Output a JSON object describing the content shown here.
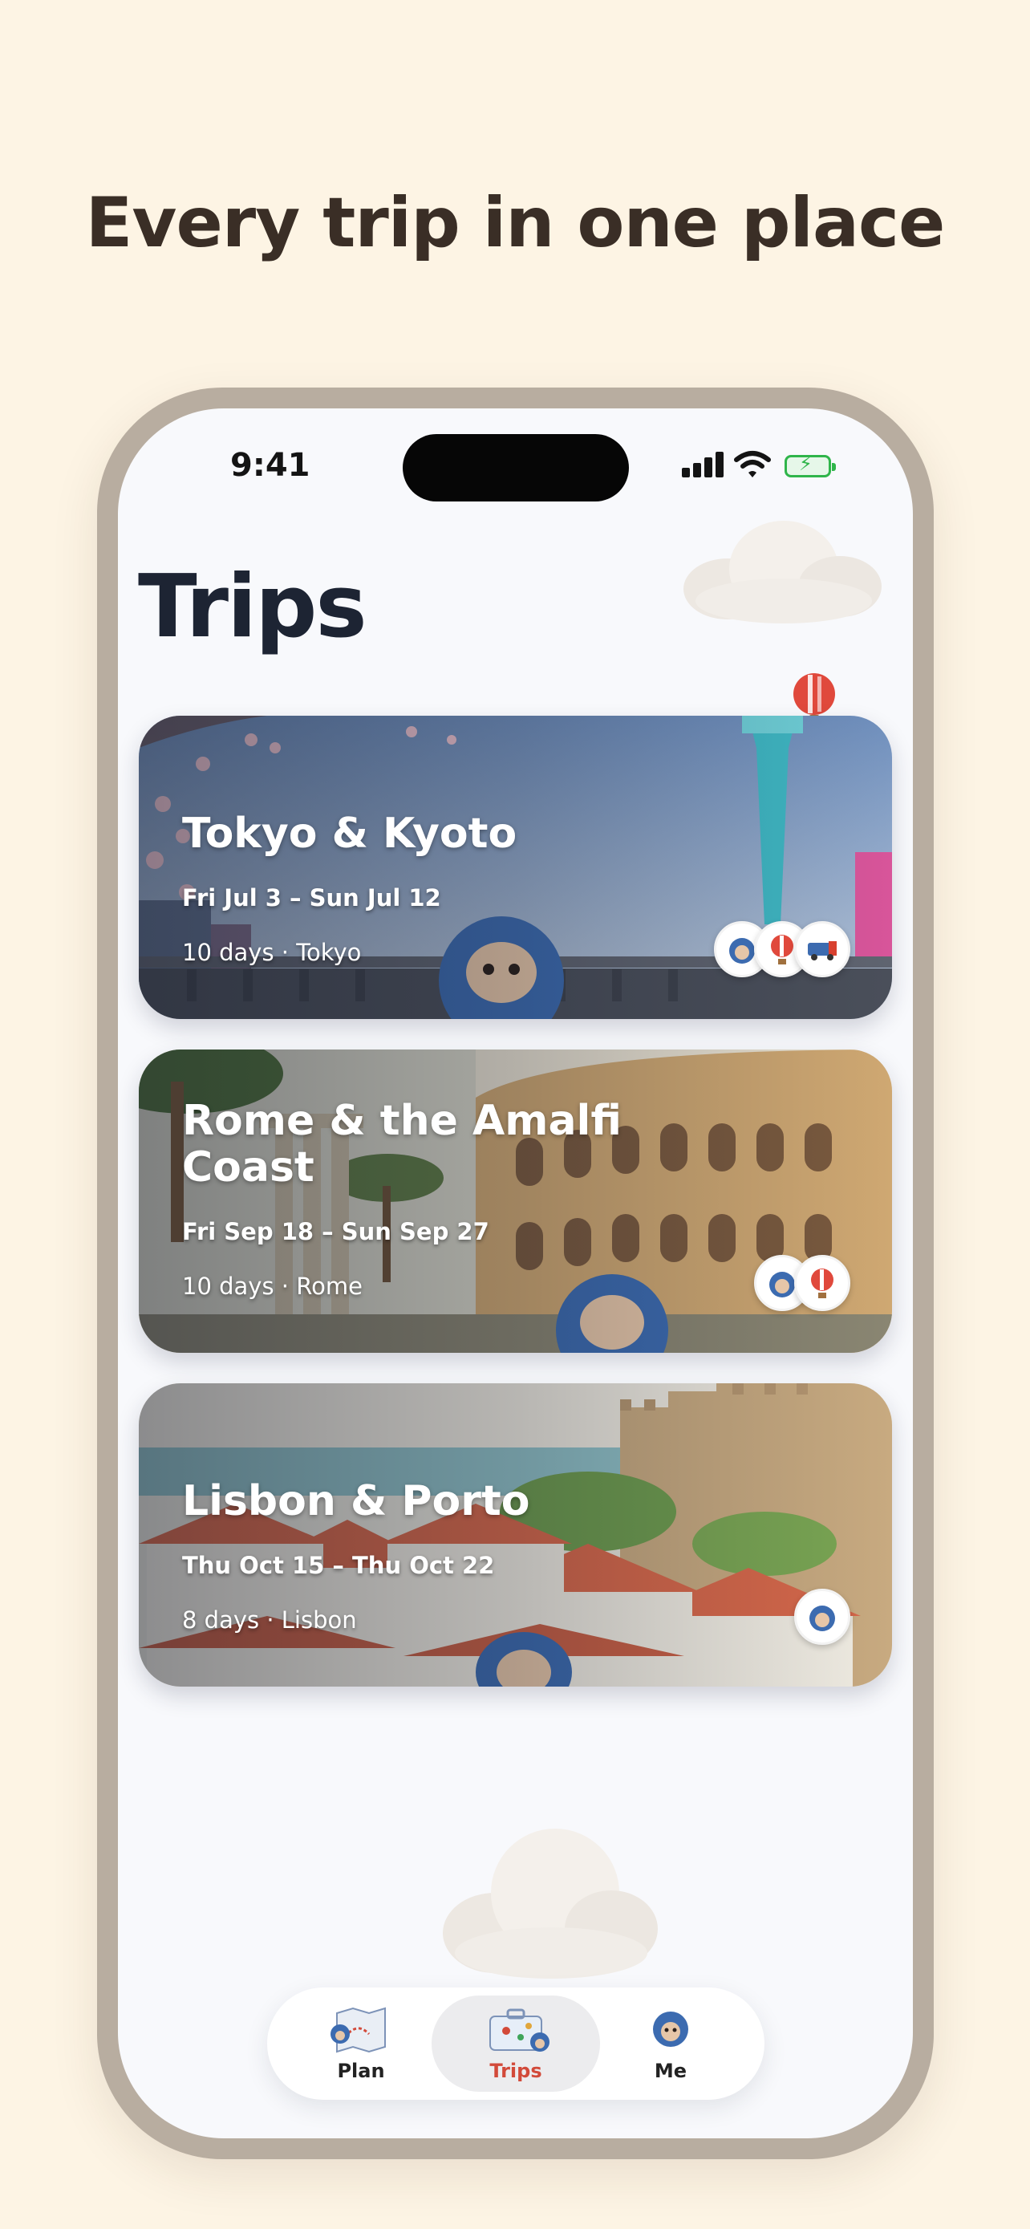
{
  "headline": "Every trip in one place",
  "status_bar": {
    "time": "9:41"
  },
  "page_title": "Trips",
  "trips": [
    {
      "title": "Tokyo & Kyoto",
      "dates": "Fri Jul 3 – Sun Jul 12",
      "meta": "10 days · Tokyo",
      "badges": [
        "mascot-icon",
        "hot-air-balloon-icon",
        "train-icon"
      ]
    },
    {
      "title": "Rome & the Amalfi Coast",
      "dates": "Fri Sep 18 – Sun Sep 27",
      "meta": "10 days · Rome",
      "badges": [
        "mascot-icon",
        "hot-air-balloon-icon"
      ]
    },
    {
      "title": "Lisbon & Porto",
      "dates": "Thu Oct 15 – Thu Oct 22",
      "meta": "8 days · Lisbon",
      "badges": [
        "mascot-icon"
      ]
    }
  ],
  "tabbar": {
    "tabs": [
      {
        "label": "Plan",
        "icon": "map-icon"
      },
      {
        "label": "Trips",
        "icon": "suitcase-icon",
        "active": true
      },
      {
        "label": "Me",
        "icon": "mascot-icon"
      }
    ]
  },
  "colors": {
    "background": "#fdf4e4",
    "headline": "#3a2e26",
    "active_tab": "#d24a3a",
    "battery": "#2fb54a"
  }
}
